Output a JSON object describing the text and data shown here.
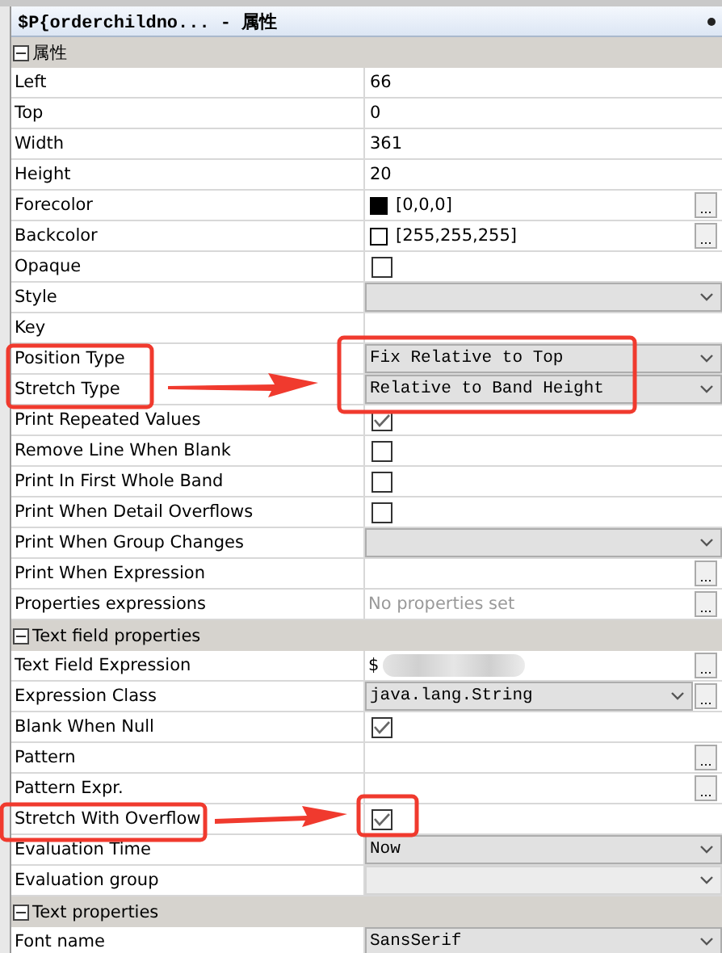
{
  "title": "$P{orderchildno... - 属性",
  "sections": [
    {
      "title": "属性",
      "expanded": true,
      "rows": [
        {
          "label": "Left",
          "kind": "text",
          "value": "66"
        },
        {
          "label": "Top",
          "kind": "text",
          "value": "0"
        },
        {
          "label": "Width",
          "kind": "text",
          "value": "361"
        },
        {
          "label": "Height",
          "kind": "text",
          "value": "20"
        },
        {
          "label": "Forecolor",
          "kind": "color",
          "value": "[0,0,0]",
          "color": "#000000",
          "button": "..."
        },
        {
          "label": "Backcolor",
          "kind": "color",
          "value": "[255,255,255]",
          "color": "#ffffff",
          "button": "..."
        },
        {
          "label": "Opaque",
          "kind": "check",
          "checked": false
        },
        {
          "label": "Style",
          "kind": "combo",
          "disabled": false
        },
        {
          "label": "Key",
          "kind": "text"
        },
        {
          "label": "Position Type",
          "kind": "combo",
          "value": "Fix Relative to Top",
          "disabled": false
        },
        {
          "label": "Stretch Type",
          "kind": "combo",
          "value": "Relative to Band Height",
          "disabled": false
        },
        {
          "label": "Print Repeated Values",
          "kind": "check",
          "checked": true
        },
        {
          "label": "Remove Line When Blank",
          "kind": "check",
          "checked": false
        },
        {
          "label": "Print In First Whole Band",
          "kind": "check",
          "checked": false
        },
        {
          "label": "Print When Detail Overflows",
          "kind": "check",
          "checked": false
        },
        {
          "label": "Print When Group Changes",
          "kind": "combo",
          "disabled": false
        },
        {
          "label": "Print When Expression",
          "kind": "expr",
          "button": "..."
        },
        {
          "label": "Properties expressions",
          "kind": "expr",
          "placeholder": "No properties set",
          "button": "..."
        }
      ]
    },
    {
      "title": "Text field properties",
      "expanded": true,
      "rows": [
        {
          "label": "Text Field Expression",
          "kind": "expr",
          "value": "$",
          "blurred": true,
          "button": "..."
        },
        {
          "label": "Expression Class",
          "kind": "combo-expr",
          "value": "java.lang.String",
          "disabled": false,
          "button": "..."
        },
        {
          "label": "Blank When Null",
          "kind": "check",
          "checked": true
        },
        {
          "label": "Pattern",
          "kind": "expr",
          "button": "..."
        },
        {
          "label": "Pattern Expr.",
          "kind": "expr",
          "button": "..."
        },
        {
          "label": "Stretch With Overflow",
          "kind": "check",
          "checked": true
        },
        {
          "label": "Evaluation Time",
          "kind": "combo",
          "value": "Now",
          "disabled": false
        },
        {
          "label": "Evaluation group",
          "kind": "combo",
          "disabled": true
        }
      ]
    },
    {
      "title": "Text properties",
      "expanded": true,
      "rows": [
        {
          "label": "Font name",
          "kind": "combo",
          "value": "SansSerif",
          "disabled": false
        }
      ]
    }
  ]
}
